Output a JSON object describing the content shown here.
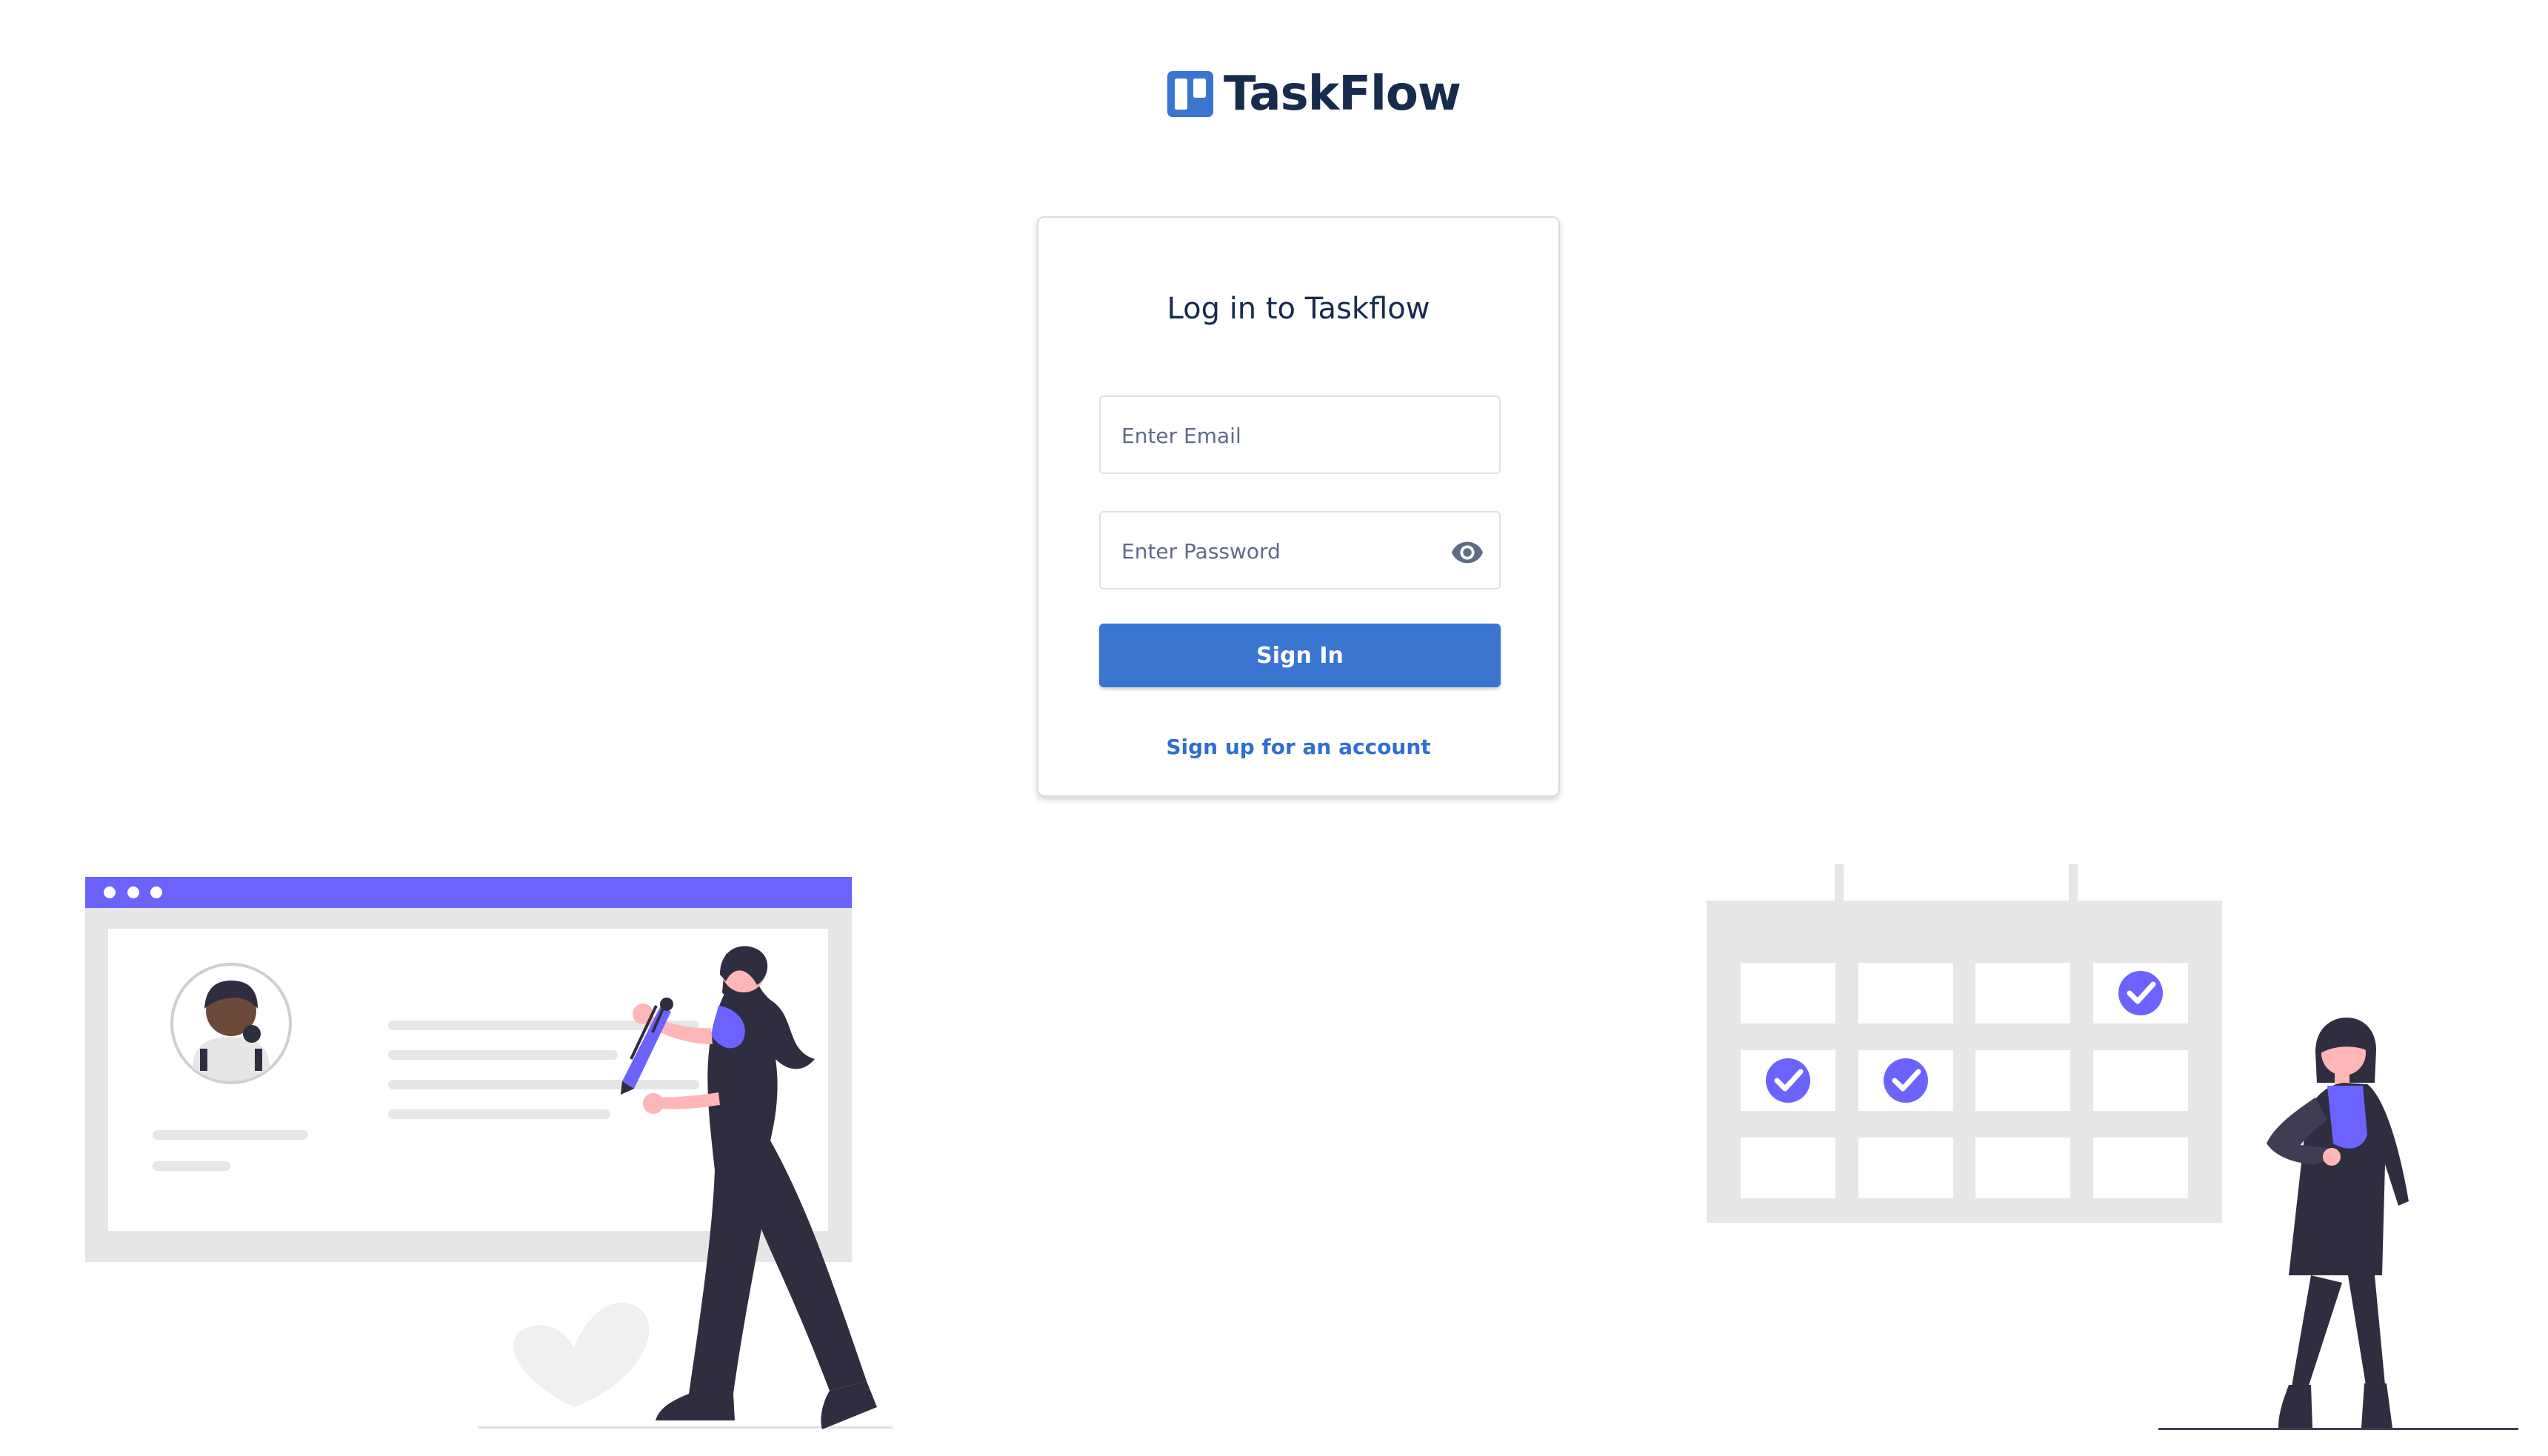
{
  "brand": {
    "name": "TaskFlow",
    "logo_icon": "board-logo-icon",
    "accent": "#3a75cf"
  },
  "login": {
    "title": "Log in to Taskflow",
    "email_placeholder": "Enter Email",
    "email_value": "",
    "password_placeholder": "Enter Password",
    "password_value": "",
    "password_toggle_icon": "eye-icon",
    "signin_label": "Sign In",
    "signup_link": "Sign up for an account",
    "button_color": "#3a75cf",
    "link_color": "#2e6fd0"
  },
  "illustrations": {
    "left": "profile-editing-illustration",
    "right": "calendar-checklist-illustration",
    "purple": "#6c63ff",
    "dark": "#2f2e41",
    "skin": "#ffb6b6",
    "gray": "#e6e6e6"
  }
}
